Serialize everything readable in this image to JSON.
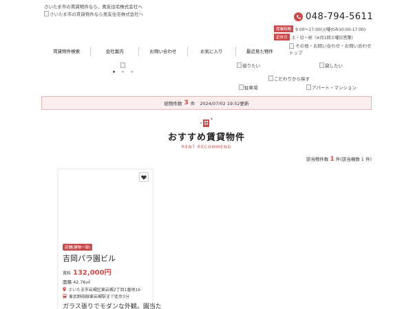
{
  "header": {
    "tagline": "さいたま市の賃貸物件なら、奥友住宅株式会社へ",
    "logo_alt": "さいたま市の賃貸物件なら奥友住宅株式会社へ",
    "phone": "048-794-5611",
    "hours_label": "営業時間",
    "hours_text": "9:00～17:00(火曜のみ10:00-17:00)",
    "closed_label": "定休日",
    "closed_text": "土・日・祝（※月1回土曜日営業)"
  },
  "nav": {
    "items": [
      {
        "label": "賃貸物件検索"
      },
      {
        "label": "会社案内"
      },
      {
        "label": "お問い合わせ"
      },
      {
        "label": "お気に入り"
      },
      {
        "label": "最近見た物件"
      }
    ],
    "other": "その他・お問い合わせ・お問い合わせトップ"
  },
  "links": {
    "borrow": "借りたい",
    "lend": "貸したい",
    "kodawari": "こだわりから探す",
    "parking": "駐車場",
    "apartment": "アパート・マンション"
  },
  "count_bar": {
    "label": "総物件数",
    "count": "3",
    "unit": "件",
    "updated": "2024/07/02 19:52更新"
  },
  "section": {
    "title": "おすすめ賃貸物件",
    "subtitle": "RENT RECOMMEND"
  },
  "result": {
    "label": "該当物件数",
    "count": "1",
    "suffix": "件(該当棟数 1 件)"
  },
  "card": {
    "tag": "店舗(建物一部)",
    "name": "吉岡パラ園ビル",
    "rent_label": "賃料",
    "rent": "132,000円",
    "area": "面積 42.76㎡",
    "address": "さいたま市岩槻区東岩槻2丁目1番地16",
    "station": "東武野田線東岩槻駅まで徒歩3分",
    "desc": "ガラス張りでモダンな外観。園当た"
  },
  "colors": {
    "accent": "#c94a4a",
    "bar_bg": "#fbeeee"
  }
}
